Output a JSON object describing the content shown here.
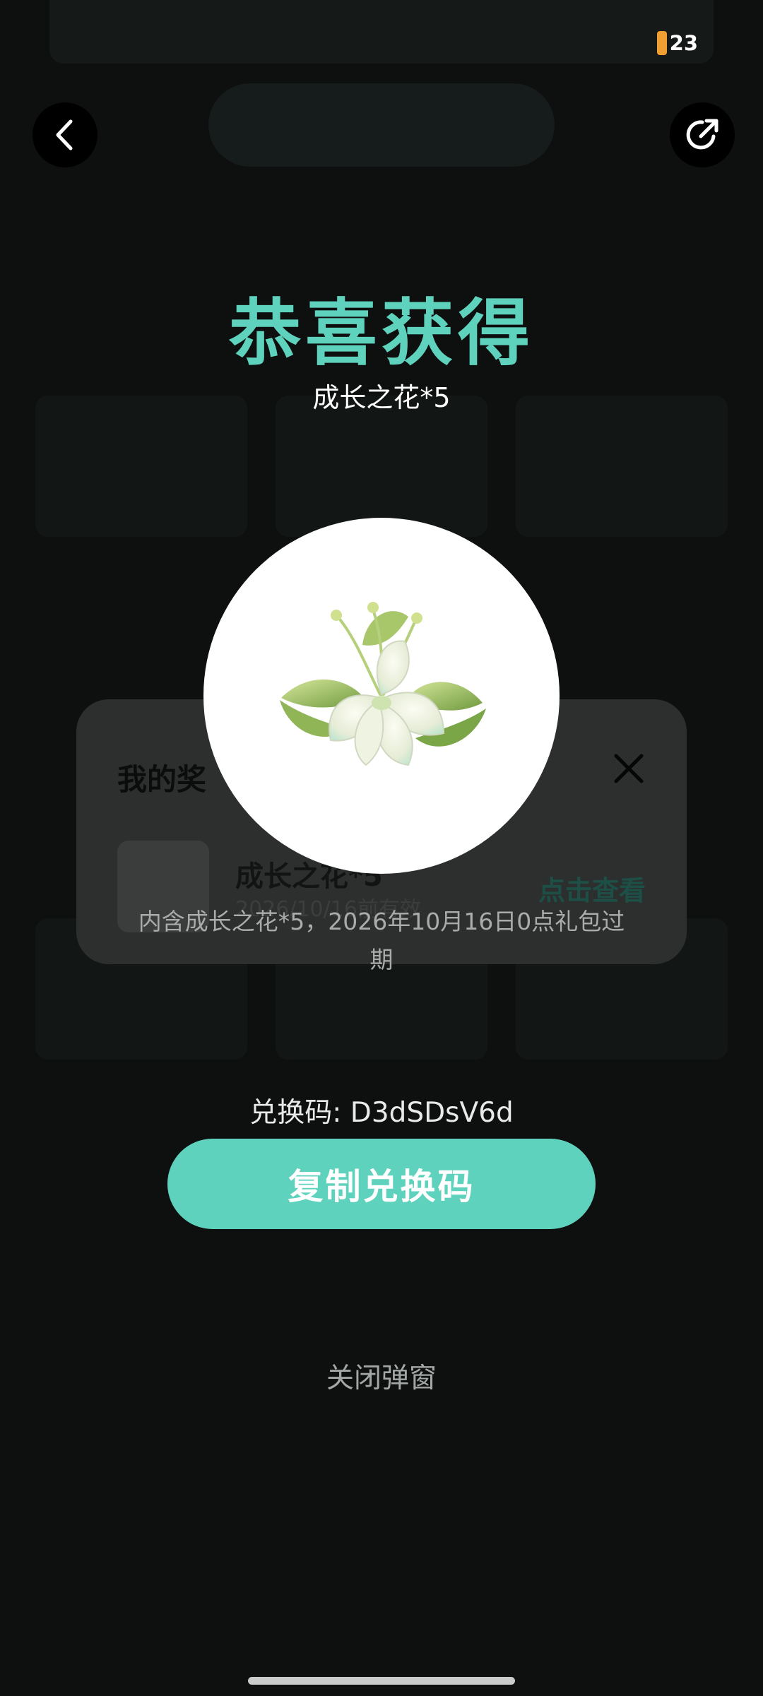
{
  "nav": {
    "back_icon": "chevron-left-icon",
    "share_icon": "share-icon"
  },
  "statusbar": {
    "battery_level": "23"
  },
  "modal": {
    "title": "恭喜获得",
    "subtitle": "成长之花*5",
    "prize_icon": "flower-icon",
    "description": "内含成长之花*5，2026年10月16日0点礼包过期",
    "redeem_code": "兑换码: D3dSDsV6d",
    "copy_button": "复制兑换码",
    "close_link": "关闭弹窗"
  },
  "rewards_panel": {
    "title": "我的奖",
    "item_name": "成长之花*5",
    "item_expiry": "2026/10/16前有效",
    "view_link": "点击查看"
  },
  "colors": {
    "accent": "#5fd2bd",
    "background": "#0d100f",
    "battery": "#f0a032"
  }
}
